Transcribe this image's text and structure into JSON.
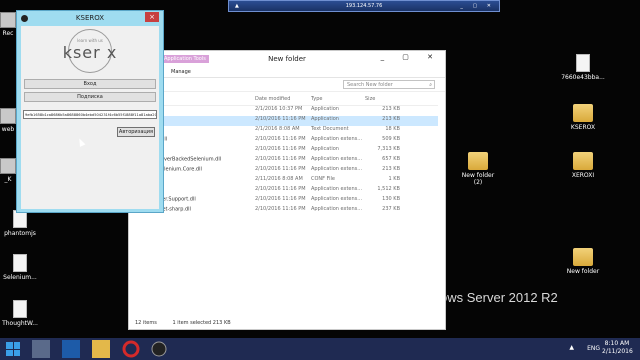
{
  "remote_bar": {
    "address": "193.124.57.76"
  },
  "os_watermark": "ows Server 2012 R2",
  "desktop_left": [
    {
      "label": "Rec"
    },
    {
      "label": "web"
    },
    {
      "label": "_K"
    },
    {
      "label": "phantomjs"
    },
    {
      "label": "Selenium..."
    },
    {
      "label": "ThoughtW..."
    }
  ],
  "desktop_right": [
    {
      "label": "7660e43bba...",
      "kind": "doc"
    },
    {
      "label": "KSEROX",
      "kind": "exe"
    },
    {
      "label": "New folder\n(2)",
      "kind": "folder"
    },
    {
      "label": "XEROXI",
      "kind": "folder"
    },
    {
      "label": "New folder",
      "kind": "folder"
    }
  ],
  "kserox_window": {
    "title": "KSEROX",
    "close": "×",
    "logo_small": "learn with us",
    "logo_big": "kser x",
    "login_button": "Вход",
    "subscribe_button": "Подписка",
    "key_value": "9efb1658b1ca8686b5a8688860b4ebd504231f4c6b55f1888f11a81aba20cdc78b",
    "auth_button": "Авторизация"
  },
  "explorer": {
    "title": "New folder",
    "app_tools": "Application Tools",
    "manage_tab": "Manage",
    "search_placeholder": "Search New folder",
    "columns": {
      "name": "",
      "date": "Date modified",
      "type": "Type",
      "size": "Size"
    },
    "rows": [
      {
        "name": "",
        "date": "2/1/2016 10:37 PM",
        "type": "Application",
        "size": "213 KB",
        "selected": false
      },
      {
        "name": "_5061_",
        "date": "2/10/2016 11:16 PM",
        "type": "Application",
        "size": "213 KB",
        "selected": true
      },
      {
        "name": "",
        "date": "2/1/2016 8:08 AM",
        "type": "Text Document",
        "size": "18 KB",
        "selected": false
      },
      {
        "name": "oft.Json.dll",
        "date": "2/10/2016 11:16 PM",
        "type": "Application extens...",
        "size": "509 KB",
        "selected": false
      },
      {
        "name": "ms",
        "date": "2/10/2016 11:16 PM",
        "type": "Application",
        "size": "7,313 KB",
        "selected": false
      },
      {
        "name": "n.WebDriverBackedSelenium.dll",
        "date": "2/10/2016 11:16 PM",
        "type": "Application extens...",
        "size": "657 KB",
        "selected": false
      },
      {
        "name": "Works.Selenium.Core.dll",
        "date": "2/10/2016 11:16 PM",
        "type": "Application extens...",
        "size": "213 KB",
        "selected": false
      },
      {
        "name": "n.conf",
        "date": "2/11/2016 8:08 AM",
        "type": "CONF File",
        "size": "1 KB",
        "selected": false
      },
      {
        "name": "er.dll",
        "date": "2/10/2016 11:16 PM",
        "type": "Application extens...",
        "size": "1,512 KB",
        "selected": false
      },
      {
        "name": "WebDriver.Support.dll",
        "date": "2/10/2016 11:16 PM",
        "type": "Application extens...",
        "size": "130 KB",
        "selected": false
      },
      {
        "name": "websocket-sharp.dll",
        "date": "2/10/2016 11:16 PM",
        "type": "Application extens...",
        "size": "237 KB",
        "selected": false
      }
    ],
    "status_count": "12 items",
    "status_selected": "1 item selected  213 KB"
  },
  "tray": {
    "lang": "ENG",
    "time": "8:10 AM",
    "date": "2/11/2016"
  }
}
